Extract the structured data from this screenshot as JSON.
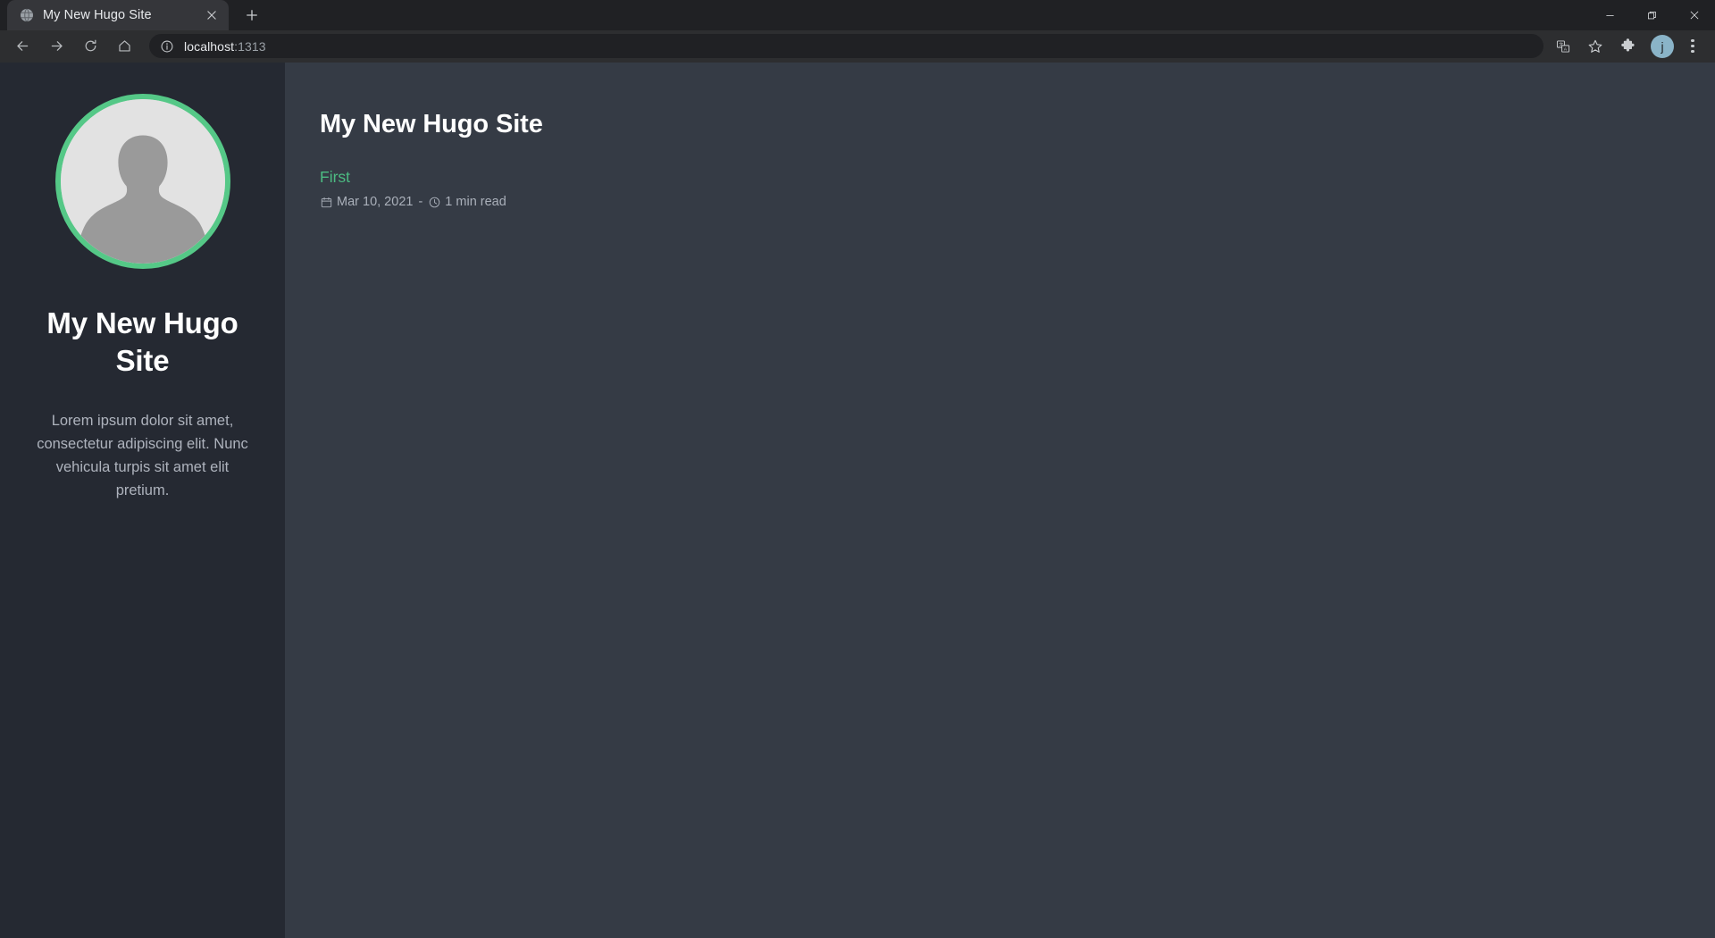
{
  "browser": {
    "tab": {
      "title": "My New Hugo Site",
      "favicon_name": "globe-icon",
      "close_label": "×",
      "new_tab_label": "+"
    },
    "window_controls": {
      "minimize": "—",
      "maximize": "❐",
      "close": "✕"
    },
    "toolbar": {
      "back": "back-arrow",
      "forward": "forward-arrow",
      "reload": "reload",
      "home": "home",
      "url_host": "localhost",
      "url_port": ":1313",
      "url_full": "localhost:1313",
      "site_info_icon": "info-circle-icon",
      "translate_icon": "translate-icon",
      "bookmark_icon": "star-icon",
      "extensions_icon": "puzzle-icon",
      "profile_initial": "j",
      "menu_icon": "three-dot-menu-icon"
    }
  },
  "page": {
    "sidebar": {
      "avatar_alt": "default-profile-photo",
      "title": "My New Hugo Site",
      "description": "Lorem ipsum dolor sit amet, consectetur adipiscing elit. Nunc vehicula turpis sit amet elit pretium."
    },
    "main": {
      "title": "My New Hugo Site",
      "posts": [
        {
          "title": "First",
          "date": "Mar 10, 2021",
          "separator": "-",
          "read_time": "1 min read",
          "date_icon": "calendar-icon",
          "read_icon": "clock-icon"
        }
      ]
    }
  },
  "colors": {
    "accent_green": "#4cbb82",
    "avatar_ring": "#55c887",
    "sidebar_bg": "#252932",
    "content_bg": "#353b45",
    "chrome_bg": "#202124",
    "toolbar_bg": "#2d2e30"
  }
}
